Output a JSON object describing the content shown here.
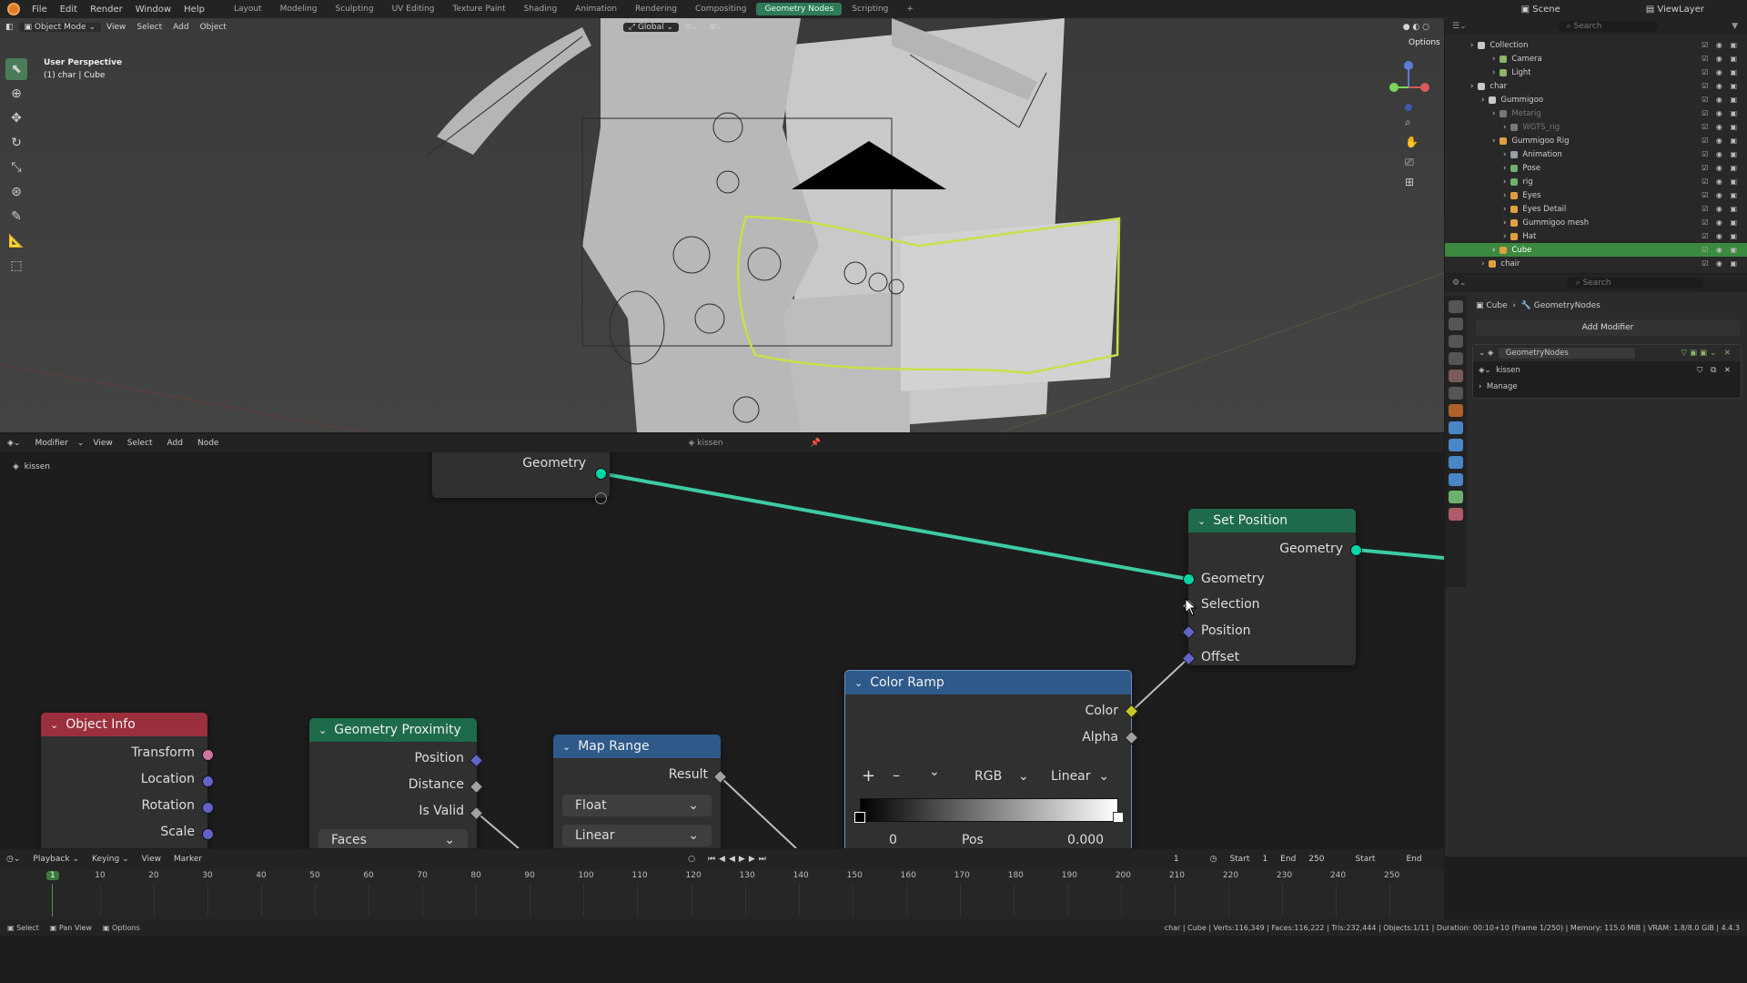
{
  "menu": {
    "items": [
      "File",
      "Edit",
      "Render",
      "Window",
      "Help"
    ],
    "workspaces": [
      "Layout",
      "Modeling",
      "Sculpting",
      "UV Editing",
      "Texture Paint",
      "Shading",
      "Animation",
      "Rendering",
      "Compositing",
      "Geometry Nodes",
      "Scripting"
    ],
    "active_workspace": "Geometry Nodes",
    "add_tab": "+",
    "scene_label": "Scene",
    "view_layer_label": "ViewLayer"
  },
  "viewport": {
    "mode": "Object Mode",
    "menu": [
      "View",
      "Select",
      "Add",
      "Object"
    ],
    "orientation": "Global",
    "options": "Options",
    "perspective": "User Perspective",
    "context": "(1) char | Cube"
  },
  "outliner": {
    "search_placeholder": "Search",
    "rows": [
      {
        "label": "Collection",
        "icon_color": "#c8c8c8",
        "indent": 0,
        "selected": false,
        "dim": false
      },
      {
        "label": "Camera",
        "icon_color": "#8fb36b",
        "indent": 2,
        "selected": false,
        "dim": false
      },
      {
        "label": "Light",
        "icon_color": "#8fb36b",
        "indent": 2,
        "selected": false,
        "dim": false
      },
      {
        "label": "char",
        "icon_color": "#c8c8c8",
        "indent": 0,
        "selected": false,
        "dim": false
      },
      {
        "label": "Gummigoo",
        "icon_color": "#c8c8c8",
        "indent": 1,
        "selected": false,
        "dim": false
      },
      {
        "label": "Metarig",
        "icon_color": "#777777",
        "indent": 2,
        "selected": false,
        "dim": true
      },
      {
        "label": "WGTS_rig",
        "icon_color": "#777777",
        "indent": 3,
        "selected": false,
        "dim": true
      },
      {
        "label": "Gummigoo Rig",
        "icon_color": "#e0a040",
        "indent": 2,
        "selected": false,
        "dim": false
      },
      {
        "label": "Animation",
        "icon_color": "#9aa0a8",
        "indent": 3,
        "selected": false,
        "dim": false
      },
      {
        "label": "Pose",
        "icon_color": "#6fb06f",
        "indent": 3,
        "selected": false,
        "dim": false
      },
      {
        "label": "rig",
        "icon_color": "#6fb06f",
        "indent": 3,
        "selected": false,
        "dim": false
      },
      {
        "label": "Eyes",
        "icon_color": "#e0a040",
        "indent": 3,
        "selected": false,
        "dim": false
      },
      {
        "label": "Eyes Detail",
        "icon_color": "#e0a040",
        "indent": 3,
        "selected": false,
        "dim": false
      },
      {
        "label": "Gummigoo mesh",
        "icon_color": "#e0a040",
        "indent": 3,
        "selected": false,
        "dim": false
      },
      {
        "label": "Hat",
        "icon_color": "#e0a040",
        "indent": 3,
        "selected": false,
        "dim": false
      },
      {
        "label": "Cube",
        "icon_color": "#e0a040",
        "indent": 2,
        "selected": true,
        "dim": false
      },
      {
        "label": "chair",
        "icon_color": "#e0a040",
        "indent": 1,
        "selected": false,
        "dim": false
      }
    ]
  },
  "properties": {
    "search_placeholder": "Search",
    "breadcrumb_object": "Cube",
    "breadcrumb_modifier": "GeometryNodes",
    "add_modifier": "Add Modifier",
    "modifier_name": "GeometryNodes",
    "node_group": "kissen",
    "manage": "Manage"
  },
  "node_editor": {
    "menu": [
      "Modifier",
      "View",
      "Select",
      "Add",
      "Node"
    ],
    "node_group": "kissen",
    "breadcrumb": "kissen",
    "group_input": {
      "output": "Geometry"
    },
    "set_position": {
      "title": "Set Position",
      "output": "Geometry",
      "inputs": [
        "Geometry",
        "Selection",
        "Position",
        "Offset"
      ]
    },
    "color_ramp": {
      "title": "Color Ramp",
      "outputs": [
        "Color",
        "Alpha"
      ],
      "add": "+",
      "remove": "–",
      "chevron": "⌄",
      "color_mode": "RGB",
      "interpolation": "Linear",
      "stop_index": "0",
      "pos_label": "Pos",
      "pos_value": "0.000"
    },
    "object_info": {
      "title": "Object Info",
      "outputs": [
        "Transform",
        "Location",
        "Rotation",
        "Scale"
      ]
    },
    "geometry_proximity": {
      "title": "Geometry Proximity",
      "outputs": [
        "Position",
        "Distance",
        "Is Valid"
      ],
      "target_element": "Faces"
    },
    "map_range": {
      "title": "Map Range",
      "output": "Result",
      "data_type": "Float",
      "interpolation": "Linear"
    }
  },
  "timeline": {
    "menu": [
      "Playback",
      "Keying",
      "View",
      "Marker"
    ],
    "current_frame": "1",
    "start_label": "Start",
    "start_value": "1",
    "end_label": "End",
    "end_value": "250",
    "start_label_2": "Start",
    "end_label_2": "End",
    "ticks": [
      "1",
      "10",
      "20",
      "30",
      "40",
      "50",
      "60",
      "70",
      "80",
      "90",
      "100",
      "110",
      "120",
      "130",
      "140",
      "150",
      "160",
      "170",
      "180",
      "190",
      "200",
      "210",
      "220",
      "230",
      "240",
      "250"
    ]
  },
  "status_bar": {
    "select": "Select",
    "pan_view": "Pan View",
    "options": "Options",
    "stats": "char | Cube | Verts:116,349 | Faces:116,222 | Tris:232,444 | Objects:1/11 | Duration: 00:10+10 (Frame 1/250) | Memory: 115.0 MiB | VRAM: 1.8/8.0 GiB | 4.4.3"
  },
  "colors": {
    "geometry_socket": "#00d6a3",
    "vector_socket": "#6363c7",
    "float_socket": "#a1a1a1",
    "matrix_socket": "#cc77a0",
    "color_socket": "#c7c729",
    "set_position_header": "#1d6b4a",
    "color_ramp_header": "#2e5a8a",
    "object_info_header": "#9c2f3d",
    "geometry_proximity_header": "#1d6b4a",
    "map_range_header": "#2e5a8a",
    "active_workspace": "#2f7a58",
    "selected_row": "#3b8a3f"
  }
}
